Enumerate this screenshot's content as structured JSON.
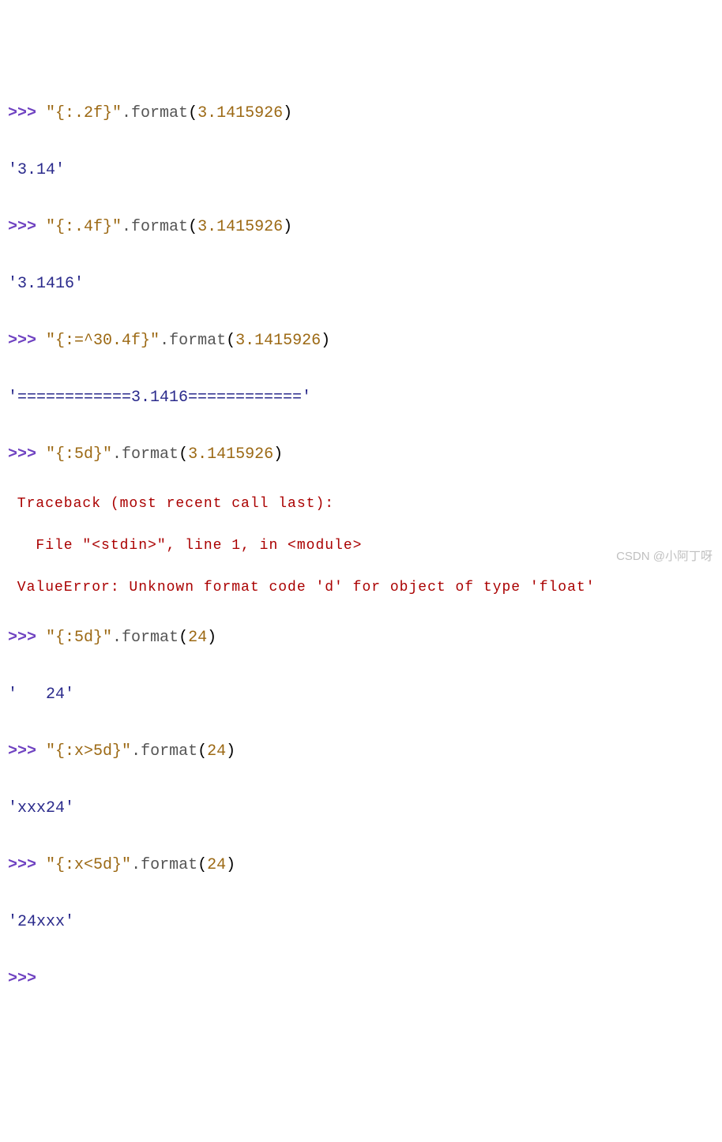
{
  "prompt": ">>>",
  "lines": [
    {
      "str": "\"{:.2f}\"",
      "method": ".format",
      "arg": "3.1415926"
    },
    {
      "out": "'3.14'"
    },
    {
      "str": "\"{:.4f}\"",
      "method": ".format",
      "arg": "3.1415926"
    },
    {
      "out": "'3.1416'"
    },
    {
      "str": "\"{:=^30.4f}\"",
      "method": ".format",
      "arg": "3.1415926"
    },
    {
      "out": "'============3.1416============'"
    },
    {
      "str": "\"{:5d}\"",
      "method": ".format",
      "arg": "3.1415926"
    },
    {
      "err1": " Traceback (most recent call last):"
    },
    {
      "err2": "   File \"<stdin>\", line 1, in <module>"
    },
    {
      "err3": " ValueError: Unknown format code 'd' for object of type 'float'"
    },
    {
      "str": "\"{:5d}\"",
      "method": ".format",
      "arg": "24"
    },
    {
      "out": "'   24'"
    },
    {
      "str": "\"{:x>5d}\"",
      "method": ".format",
      "arg": "24"
    },
    {
      "out": "'xxx24'"
    },
    {
      "str": "\"{:x<5d}\"",
      "method": ".format",
      "arg": "24"
    },
    {
      "out": "'24xxx'"
    },
    {
      "emptyprompt": true
    }
  ],
  "watermark": "CSDN @小阿丁呀"
}
